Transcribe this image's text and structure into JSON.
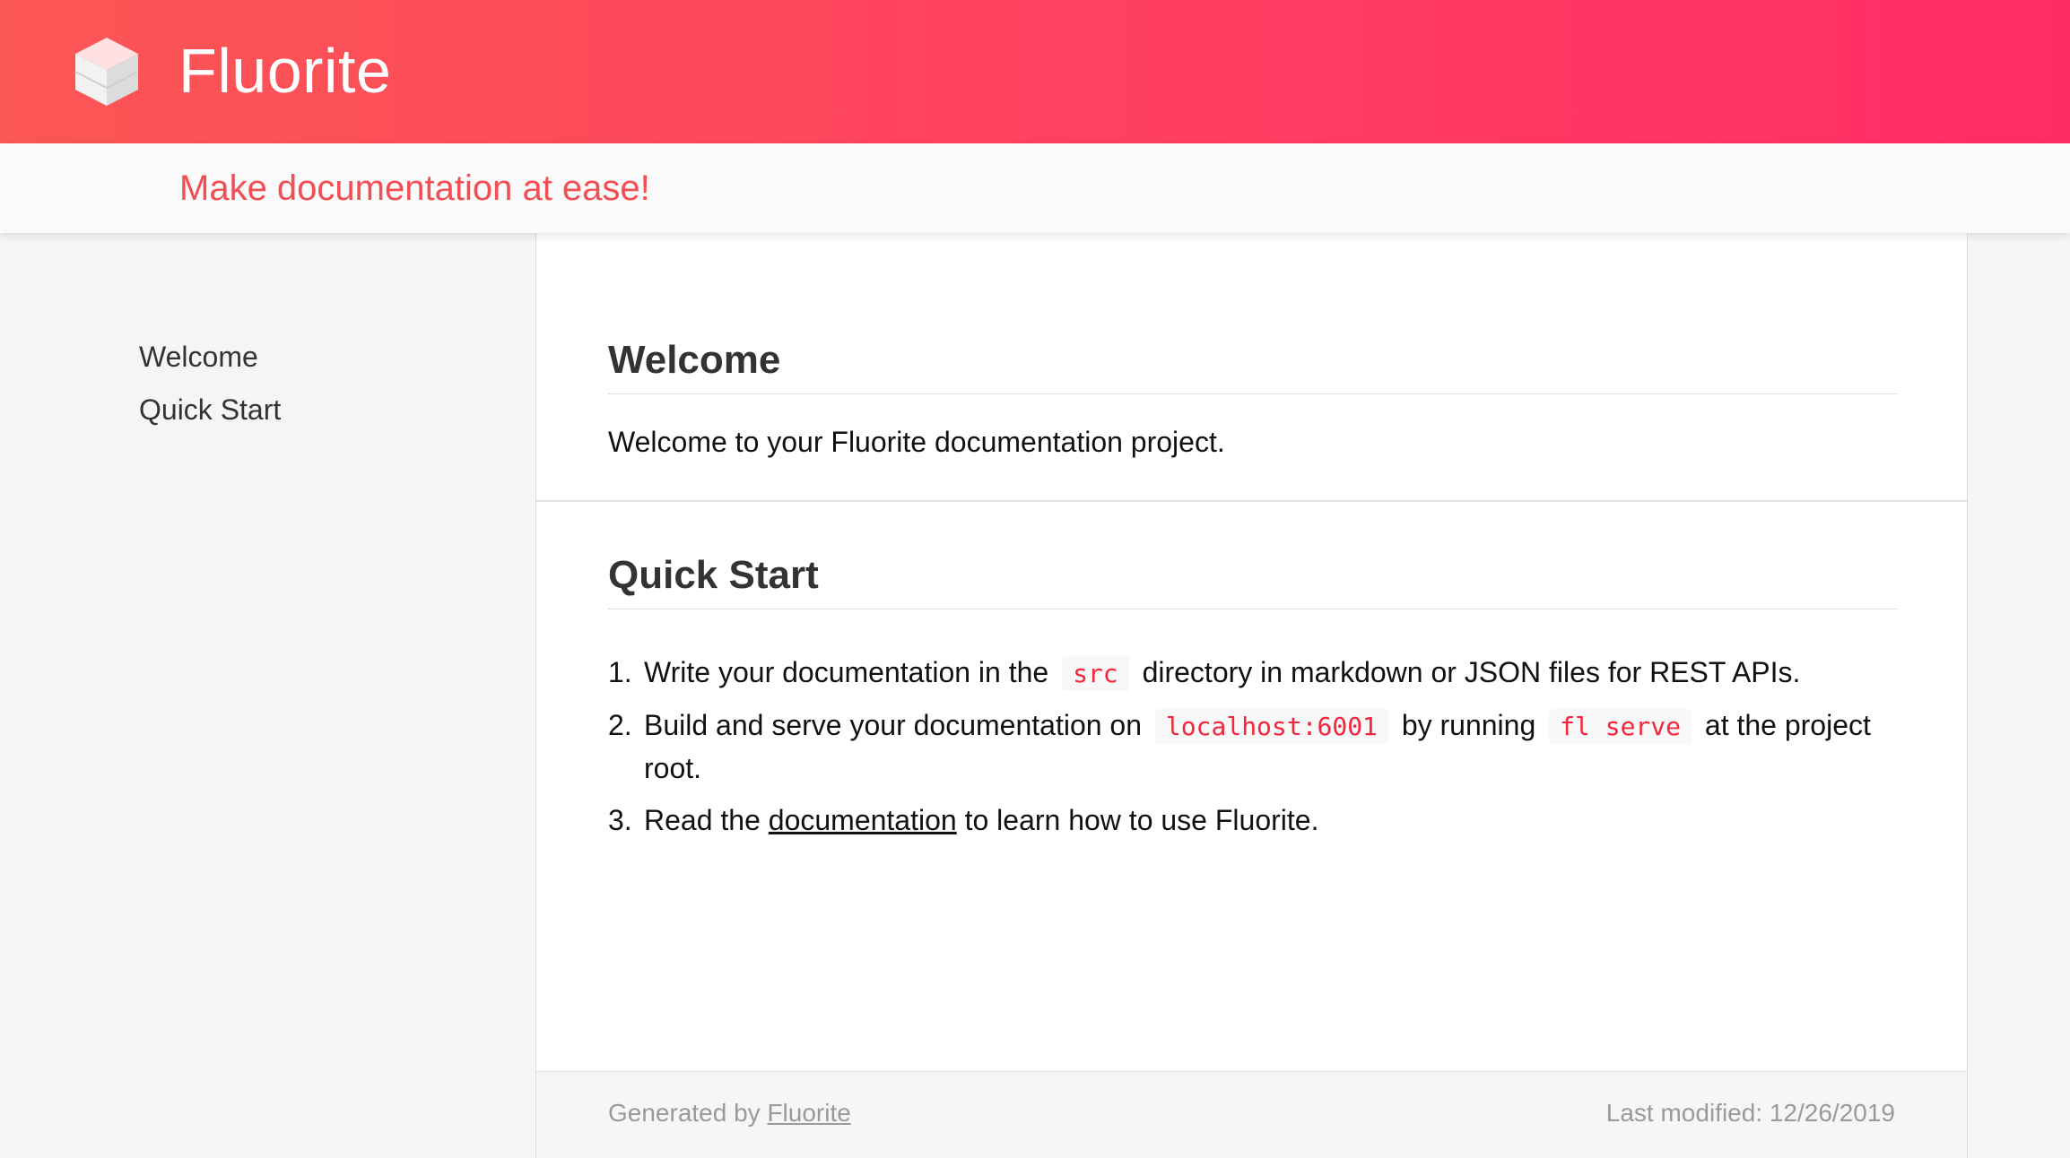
{
  "header": {
    "app_title": "Fluorite",
    "logo_icon": "cube-icon",
    "gradient_start": "#fb5754",
    "gradient_end": "#ff2d66"
  },
  "tagline": {
    "text": "Make documentation at ease!",
    "color": "#f24e53"
  },
  "sidebar": {
    "items": [
      {
        "label": "Welcome"
      },
      {
        "label": "Quick Start"
      }
    ]
  },
  "main": {
    "welcome": {
      "title": "Welcome",
      "text": "Welcome to your Fluorite documentation project."
    },
    "quick_start": {
      "title": "Quick Start",
      "steps": [
        {
          "number": "1.",
          "before": "Write your documentation in the",
          "code": "src",
          "after": "directory in markdown or JSON files for REST APIs."
        },
        {
          "number": "2.",
          "before": "Build and serve your documentation on",
          "code1": "localhost:6001",
          "middle": "by running",
          "code2": "fl serve",
          "after": "at the project root."
        },
        {
          "number": "3.",
          "before": "Read the",
          "link": "documentation",
          "after": "to learn how to use Fluorite."
        }
      ]
    }
  },
  "footer": {
    "generated_prefix": "Generated by",
    "generated_link": "Fluorite",
    "last_modified": "Last modified: 12/26/2019"
  },
  "colors": {
    "code_text": "#f5263c",
    "accent": "#ff3f60"
  }
}
